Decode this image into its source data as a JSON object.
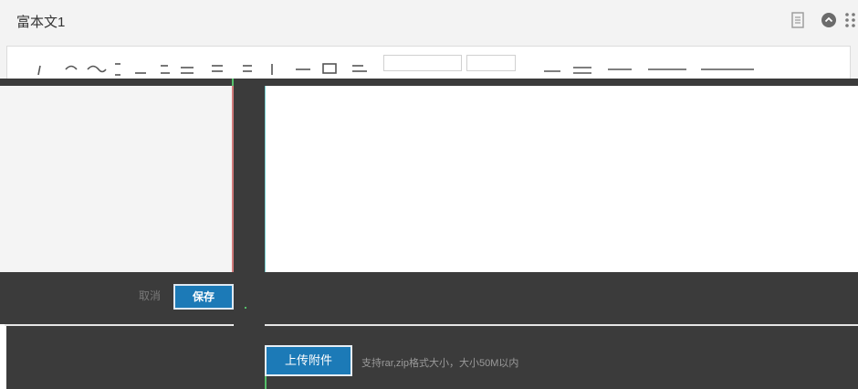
{
  "window": {
    "title": "富本文1"
  },
  "header": {
    "icons": [
      "document-icon",
      "collapse-icon",
      "grid-menu-icon"
    ]
  },
  "toolbar": {
    "icons": [
      "italic-icon",
      "undo-icon",
      "redo-icon",
      "bold-icon",
      "italic-icon",
      "underline-icon",
      "strikethrough-icon",
      "list-icon",
      "align-icon",
      "font-color-icon",
      "link-icon",
      "table-icon",
      "format-icon",
      "insert-icon",
      "image-icon",
      "emoji-icon",
      "code-icon",
      "subscript-icon",
      "superscript-icon",
      "quote-icon",
      "hr-icon",
      "preview-icon",
      "fullscreen-icon",
      "settings-icon"
    ],
    "paragraph_select": "",
    "size_select": ""
  },
  "footer": {
    "cancel_label": "取消",
    "save_label": "保存",
    "upload_label": "上传附件",
    "upload_hint": "支持rar,zip格式大小，大小50M以内"
  },
  "colors": {
    "accent": "#1c7ab7",
    "dark_band": "#3b3b3b",
    "header_bg": "#f3f3f3",
    "panel_bg": "#f4f4f4"
  }
}
